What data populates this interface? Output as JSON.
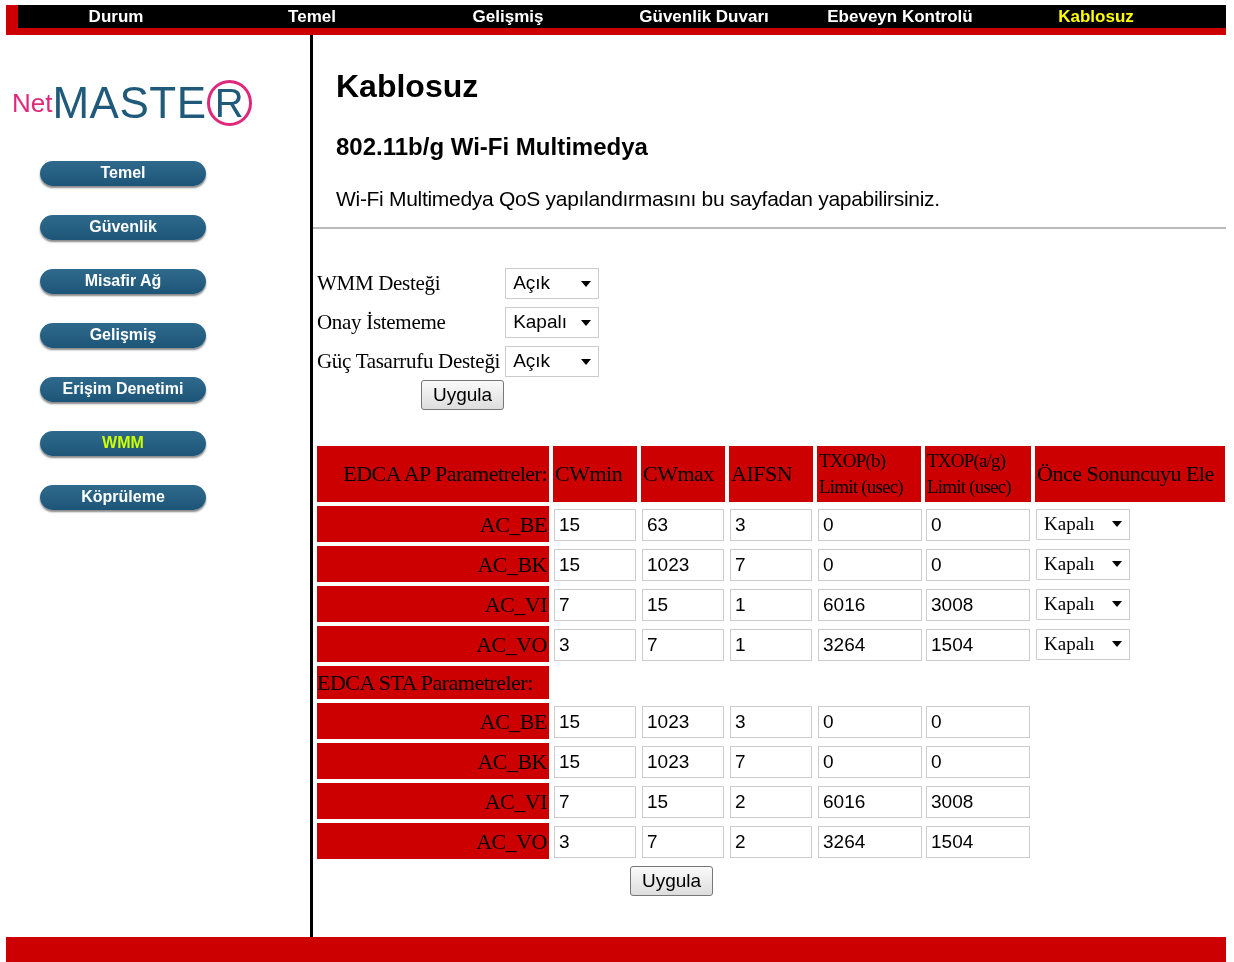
{
  "nav": [
    {
      "label": "Durum",
      "selected": false
    },
    {
      "label": "Temel",
      "selected": false
    },
    {
      "label": "Gelişmiş",
      "selected": false
    },
    {
      "label": "Güvenlik Duvarı",
      "selected": false
    },
    {
      "label": "Ebeveyn Kontrolü",
      "selected": false
    },
    {
      "label": "Kablosuz",
      "selected": true
    }
  ],
  "logo": {
    "prefix": "Net",
    "main": "MASTE",
    "circled": "R"
  },
  "sidebar": [
    {
      "label": "Temel",
      "selected": false
    },
    {
      "label": "Güvenlik",
      "selected": false
    },
    {
      "label": "Misafir Ağ",
      "selected": false
    },
    {
      "label": "Gelişmiş",
      "selected": false
    },
    {
      "label": "Erişim Denetimi",
      "selected": false
    },
    {
      "label": "WMM",
      "selected": true
    },
    {
      "label": "Köprüleme",
      "selected": false
    }
  ],
  "page": {
    "title": "Kablosuz",
    "subtitle": "802.11b/g Wi-Fi Multimedya",
    "description": "Wi-Fi Multimedya QoS yapılandırmasını bu sayfadan yapabilirsiniz."
  },
  "settings": [
    {
      "label": "WMM Desteği",
      "value": "Açık"
    },
    {
      "label": "Onay İstememe",
      "value": "Kapalı"
    },
    {
      "label": "Güç Tasarrufu Desteği",
      "value": "Açık"
    }
  ],
  "settings_button": "Uygula",
  "edca": {
    "columns": [
      "EDCA AP Parametreler:",
      "CWmin",
      "CWmax",
      "AIFSN",
      "TXOP(b) Limit (usec)",
      "TXOP(a/g) Limit (usec)",
      "Önce Sonuncuyu Ele"
    ],
    "sections": [
      {
        "rows": [
          {
            "name": "AC_BE",
            "values": [
              "15",
              "63",
              "3",
              "0",
              "0"
            ],
            "policy": "Kapalı"
          },
          {
            "name": "AC_BK",
            "values": [
              "15",
              "1023",
              "7",
              "0",
              "0"
            ],
            "policy": "Kapalı"
          },
          {
            "name": "AC_VI",
            "values": [
              "7",
              "15",
              "1",
              "6016",
              "3008"
            ],
            "policy": "Kapalı"
          },
          {
            "name": "AC_VO",
            "values": [
              "3",
              "7",
              "1",
              "3264",
              "1504"
            ],
            "policy": "Kapalı"
          }
        ]
      },
      {
        "label": "EDCA STA Parametreler:",
        "rows": [
          {
            "name": "AC_BE",
            "values": [
              "15",
              "1023",
              "3",
              "0",
              "0"
            ]
          },
          {
            "name": "AC_BK",
            "values": [
              "15",
              "1023",
              "7",
              "0",
              "0"
            ]
          },
          {
            "name": "AC_VI",
            "values": [
              "7",
              "15",
              "2",
              "6016",
              "3008"
            ]
          },
          {
            "name": "AC_VO",
            "values": [
              "3",
              "7",
              "2",
              "3264",
              "1504"
            ]
          }
        ]
      }
    ]
  },
  "table_button": "Uygula"
}
